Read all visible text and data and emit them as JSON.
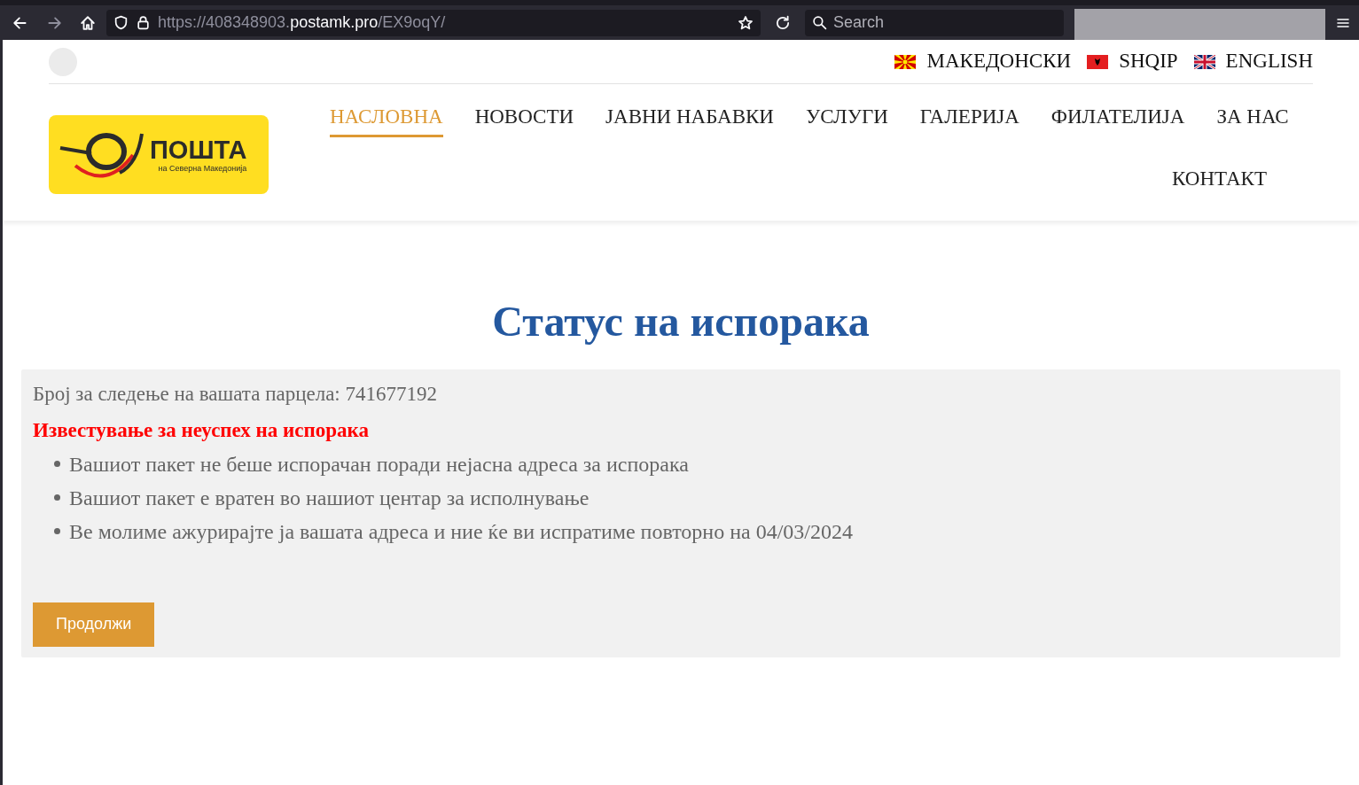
{
  "browser": {
    "url": {
      "scheme_part": "https://408348903.",
      "host": "postamk.pro",
      "path": "/EX9oqY/"
    },
    "search_placeholder": "Search"
  },
  "languages": [
    {
      "label": "МАКЕДОНСКИ",
      "kind": "mk"
    },
    {
      "label": "SHQIP",
      "kind": "al"
    },
    {
      "label": "ENGLISH",
      "kind": "en"
    }
  ],
  "logo": {
    "name": "ПОШТА",
    "subtitle": "на Северна Македонија"
  },
  "nav": [
    {
      "label": "НАСЛОВНА",
      "selected": true
    },
    {
      "label": "НОВОСТИ",
      "selected": false
    },
    {
      "label": "ЈАВНИ НАБАВКИ",
      "selected": false
    },
    {
      "label": "УСЛУГИ",
      "selected": false
    },
    {
      "label": "ГАЛЕРИЈА",
      "selected": false
    },
    {
      "label": "ФИЛАТЕЛИЈА",
      "selected": false
    },
    {
      "label": "ЗА НАС",
      "selected": false
    },
    {
      "label": "КОНТАКТ",
      "selected": false
    }
  ],
  "page_title": "Статус на испорака",
  "status": {
    "tracking": "Број за следење на вашата парцела: 741677192",
    "alert": "Известување за неуспех на испорака",
    "items": [
      "Вашиот пакет не беше испорачан поради нејасна адреса за испорака",
      "Вашиот пакет е вратен во нашиот центар за исполнување",
      "Ве молиме ажурирајте ја вашата адреса и ние ќе ви испратиме повторно на 04/03/2024"
    ],
    "button": "Продолжи"
  }
}
